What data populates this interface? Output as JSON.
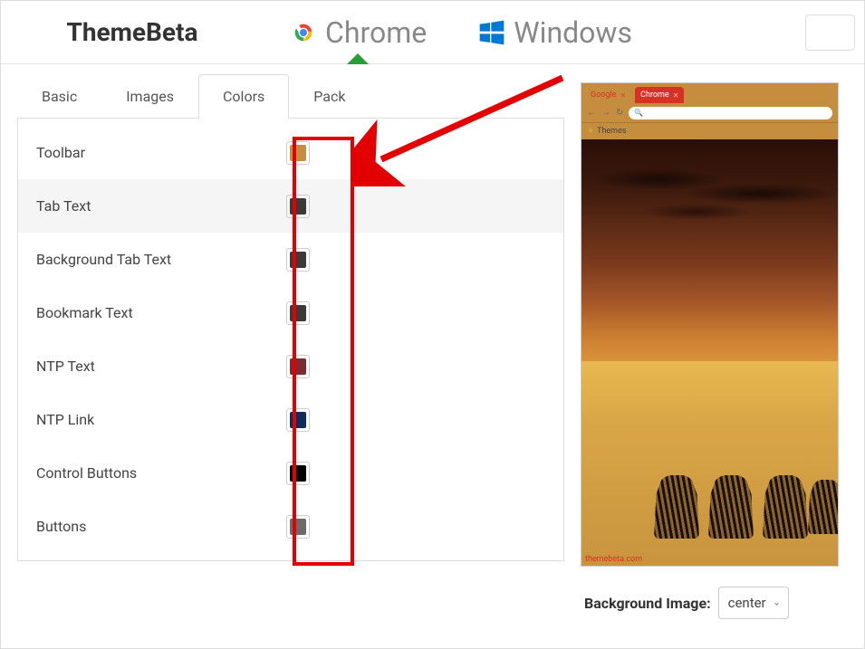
{
  "header": {
    "logo": "ThemeBeta",
    "nav": {
      "chrome": "Chrome",
      "windows": "Windows"
    }
  },
  "tabs": {
    "basic": "Basic",
    "images": "Images",
    "colors": "Colors",
    "pack": "Pack"
  },
  "colors": [
    {
      "label": "Toolbar",
      "value": "#c58e3f",
      "highlighted": false
    },
    {
      "label": "Tab Text",
      "value": "#3a3a3a",
      "highlighted": true
    },
    {
      "label": "Background Tab Text",
      "value": "#3a3a3a",
      "highlighted": false
    },
    {
      "label": "Bookmark Text",
      "value": "#3a3a3a",
      "highlighted": false
    },
    {
      "label": "NTP Text",
      "value": "#7a2b33",
      "highlighted": false
    },
    {
      "label": "NTP Link",
      "value": "#0d2d5f",
      "highlighted": false
    },
    {
      "label": "Control Buttons",
      "value": "#000000",
      "highlighted": false
    },
    {
      "label": "Buttons",
      "value": "#6b6b6b",
      "highlighted": false
    }
  ],
  "preview": {
    "tab_inactive": "Google",
    "tab_active": "Chrome",
    "bookmarks_label": "Themes",
    "watermark": "themebeta.com"
  },
  "bg_option": {
    "label": "Background Image:",
    "value": "center"
  }
}
